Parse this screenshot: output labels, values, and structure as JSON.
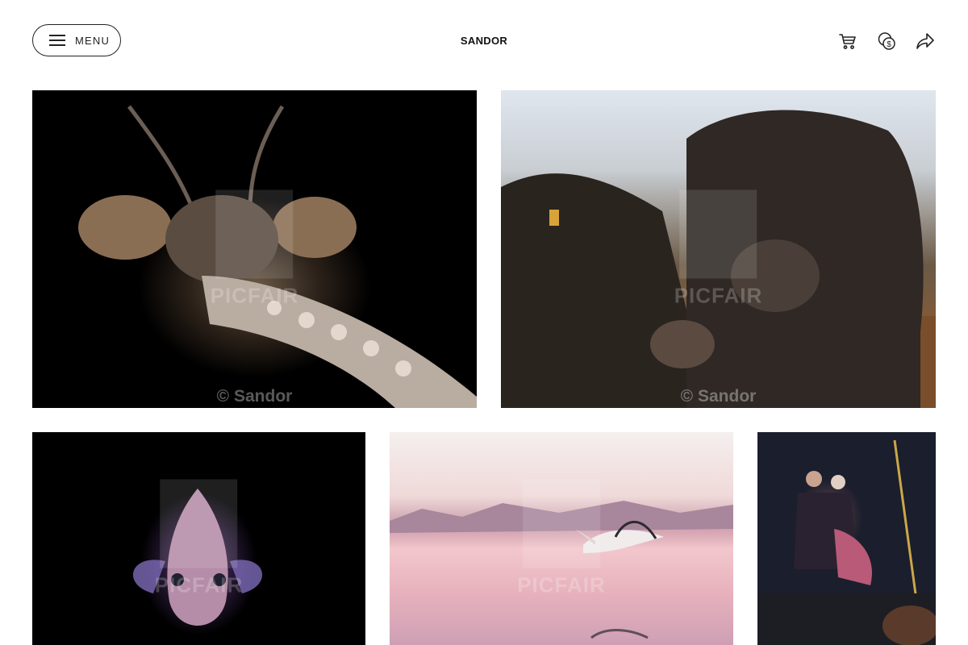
{
  "header": {
    "menu_label": "MENU",
    "brand": "SANDOR",
    "icons": [
      "shopping-cart-icon",
      "currency-exchange-icon",
      "share-icon"
    ]
  },
  "photos": [
    {
      "subject": "praying mantis close-up",
      "watermark": "PICFAIR",
      "credit": "© Sandor"
    },
    {
      "subject": "two black cows",
      "watermark": "PICFAIR",
      "credit": "© Sandor"
    },
    {
      "subject": "scorpionfish on black background",
      "watermark": "PICFAIR",
      "credit": ""
    },
    {
      "subject": "pelican flying over pink lake",
      "watermark": "PICFAIR",
      "credit": ""
    },
    {
      "subject": "dancers on stage with instruments",
      "watermark": "",
      "credit": ""
    }
  ],
  "colors": {
    "text": "#111111",
    "border": "#222222",
    "background": "#ffffff"
  }
}
